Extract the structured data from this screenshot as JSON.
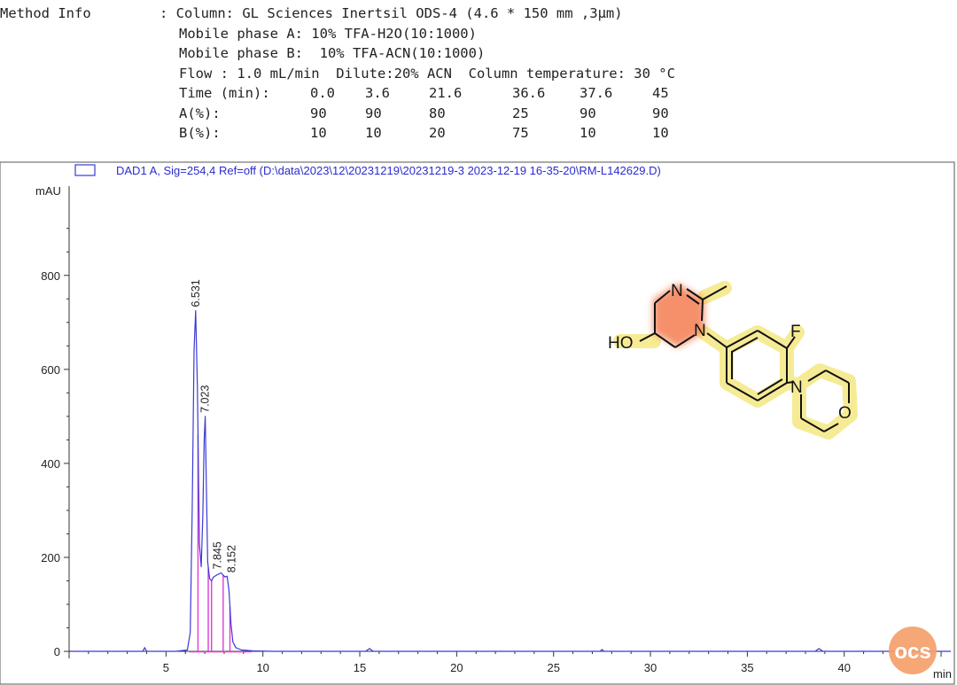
{
  "method": {
    "label": "Method Info",
    "lines": [
      ": Column: GL Sciences Inertsil ODS-4 (4.6 * 150 mm ,3μm)",
      "Mobile phase A: 10% TFA-H2O(10:1000)",
      "Mobile phase B:  10% TFA-ACN(10:1000)",
      "Flow : 1.0 mL/min  Dilute:20% ACN  Column temperature: 30 °C"
    ],
    "gradient": {
      "time_label": "Time (min):",
      "a_label": "A(%):",
      "b_label": "B(%):",
      "time": [
        "0.0",
        "3.6",
        "21.6",
        "36.6",
        "37.6",
        "45"
      ],
      "a": [
        "90",
        "90",
        "80",
        "25",
        "90",
        "90"
      ],
      "b": [
        "10",
        "10",
        "20",
        "75",
        "10",
        "10"
      ]
    }
  },
  "chart_data": {
    "type": "line",
    "legend": "DAD1 A, Sig=254,4 Ref=off (D:\\data\\2023\\12\\20231219\\20231219-3 2023-12-19 16-35-20\\RM-L142629.D)",
    "ylabel": "mAU",
    "xlabel": "min",
    "xlim": [
      0,
      45.5
    ],
    "ylim": [
      -15,
      990
    ],
    "x_ticks": [
      5,
      10,
      15,
      20,
      25,
      30,
      35,
      40
    ],
    "y_ticks": [
      0,
      200,
      400,
      600,
      800
    ],
    "peaks": [
      {
        "rt": 6.531,
        "label": "6.531",
        "height": 725
      },
      {
        "rt": 7.023,
        "label": "7.023",
        "height": 500
      },
      {
        "rt": 7.845,
        "label": "7.845",
        "height": 167
      },
      {
        "rt": 8.152,
        "label": "8.152",
        "height": 160
      }
    ],
    "integration_drops": [
      6.65,
      7.18,
      7.35,
      7.95,
      8.3
    ],
    "series": [
      {
        "color": "#3a3ad6",
        "x": [
          0,
          2,
          3.8,
          3.9,
          4.0,
          5.5,
          6.1,
          6.25,
          6.35,
          6.45,
          6.531,
          6.62,
          6.72,
          6.82,
          6.9,
          6.97,
          7.023,
          7.08,
          7.15,
          7.25,
          7.35,
          7.45,
          7.6,
          7.845,
          7.95,
          8.05,
          8.152,
          8.25,
          8.35,
          8.45,
          8.6,
          8.9,
          9.5,
          10.5,
          15.3,
          15.5,
          15.7,
          20,
          27.4,
          27.5,
          27.6,
          30,
          35,
          38.5,
          38.7,
          38.9,
          42,
          45.5
        ],
        "y": [
          0,
          0,
          0,
          8,
          0,
          0,
          3,
          40,
          300,
          640,
          725,
          560,
          230,
          180,
          290,
          450,
          500,
          360,
          190,
          155,
          150,
          158,
          162,
          167,
          162,
          158,
          160,
          130,
          60,
          20,
          8,
          3,
          1,
          0,
          0,
          6,
          0,
          0,
          0,
          4,
          0,
          0,
          0,
          0,
          6,
          0,
          0,
          0
        ]
      }
    ]
  },
  "structure": {
    "atoms": [
      "N",
      "N",
      "HO",
      "F",
      "N",
      "O"
    ]
  },
  "logo": {
    "text": "ocs"
  }
}
